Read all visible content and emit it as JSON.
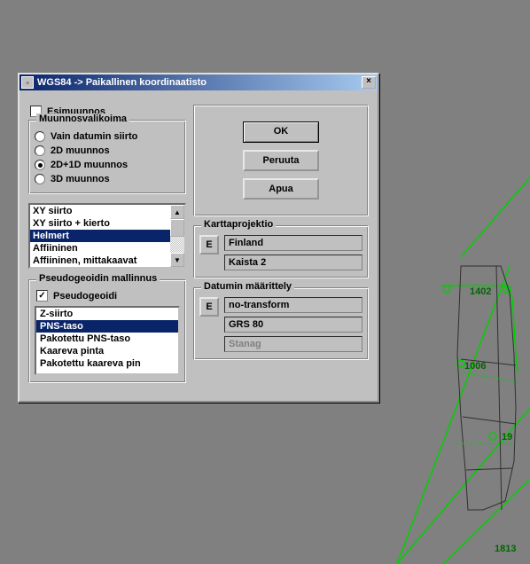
{
  "window": {
    "title": "WGS84 -> Paikallinen koordinaatisto"
  },
  "esimuunnos": {
    "label": "Esimuunnos",
    "checked": false
  },
  "muunnos": {
    "title": "Muunnosvalikoima",
    "radios": [
      {
        "label": "Vain datumin siirto",
        "selected": false
      },
      {
        "label": "2D muunnos",
        "selected": false
      },
      {
        "label": "2D+1D muunnos",
        "selected": true
      },
      {
        "label": "3D muunnos",
        "selected": false
      }
    ],
    "list": [
      {
        "label": "XY siirto",
        "selected": false
      },
      {
        "label": "XY siirto + kierto",
        "selected": false
      },
      {
        "label": "Helmert",
        "selected": true
      },
      {
        "label": "Affiininen",
        "selected": false
      },
      {
        "label": "Affiininen, mittakaavat",
        "selected": false
      }
    ]
  },
  "pseudo": {
    "title": "Pseudogeoidin mallinnus",
    "check": {
      "label": "Pseudogeoidi",
      "checked": true
    },
    "list": [
      {
        "label": "Z-siirto",
        "selected": false
      },
      {
        "label": "PNS-taso",
        "selected": true
      },
      {
        "label": "Pakotettu PNS-taso",
        "selected": false
      },
      {
        "label": "Kaareva pinta",
        "selected": false
      },
      {
        "label": "Pakotettu kaareva pin",
        "selected": false
      }
    ]
  },
  "buttons": {
    "ok": "OK",
    "cancel": "Peruuta",
    "help": "Apua",
    "edit": "E"
  },
  "kartta": {
    "title": "Karttaprojektio",
    "rows": [
      "Finland",
      "Kaista 2"
    ]
  },
  "datum": {
    "title": "Datumin määrittely",
    "rows": [
      "no-transform",
      "GRS 80",
      "Stanag"
    ]
  },
  "map": {
    "labels": [
      "1402",
      "1006",
      "19",
      "1813"
    ]
  }
}
